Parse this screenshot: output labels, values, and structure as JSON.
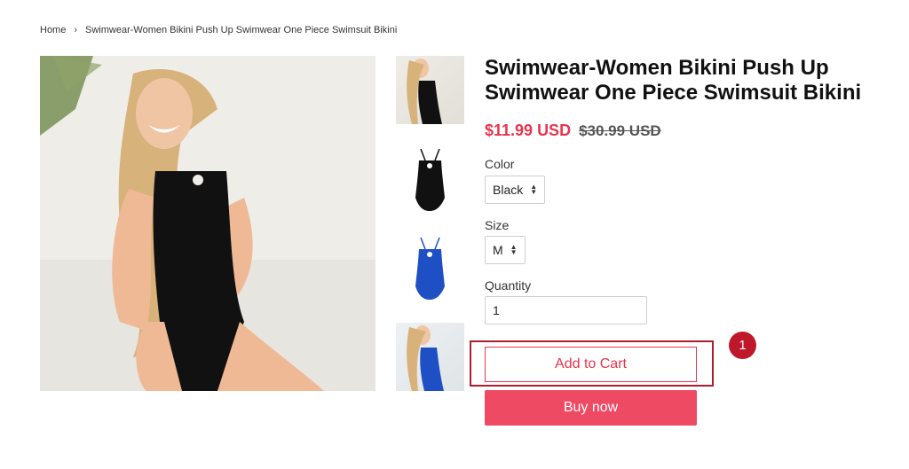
{
  "breadcrumb": {
    "home": "Home",
    "separator": "›",
    "current": "Swimwear-Women Bikini Push Up Swimwear One Piece Swimsuit Bikini"
  },
  "product": {
    "title": "Swimwear-Women Bikini Push Up Swimwear One Piece Swimsuit Bikini",
    "sale_price": "$11.99 USD",
    "compare_price": "$30.99 USD",
    "colors": {
      "sale": "#e8344e",
      "button": "#ef4a63",
      "annotation": "#c0182b",
      "swimsuit_black": "#111111",
      "swimsuit_blue": "#1f4fc4"
    }
  },
  "options": {
    "color_label": "Color",
    "color_value": "Black",
    "size_label": "Size",
    "size_value": "M",
    "quantity_label": "Quantity",
    "quantity_value": "1"
  },
  "actions": {
    "add_to_cart": "Add to Cart",
    "buy_now": "Buy now"
  },
  "annotation": {
    "step_number": "1"
  },
  "thumbnails": [
    {
      "name": "model-black-swimsuit"
    },
    {
      "name": "black-swimsuit-product"
    },
    {
      "name": "blue-swimsuit-product"
    },
    {
      "name": "model-blue-swimsuit"
    }
  ]
}
